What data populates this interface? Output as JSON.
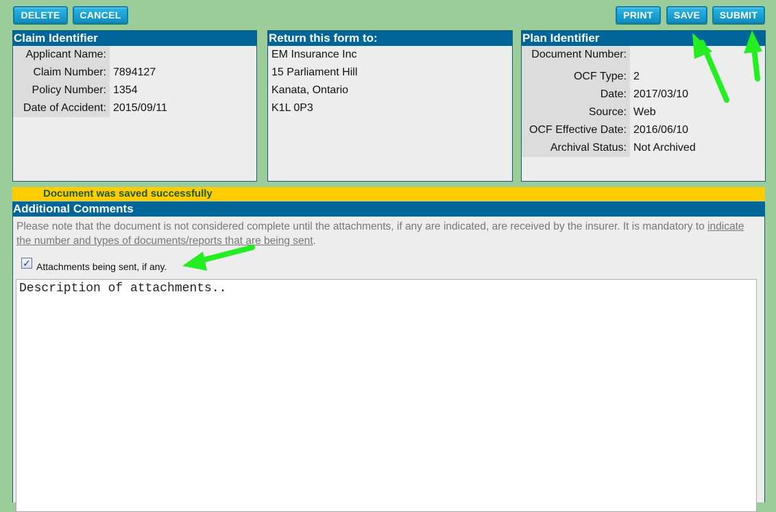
{
  "toolbar": {
    "delete_label": "DELETE",
    "cancel_label": "CANCEL",
    "print_label": "PRINT",
    "save_label": "SAVE",
    "submit_label": "SUBMIT"
  },
  "claim_panel": {
    "title": "Claim Identifier",
    "fields": [
      {
        "label": "Applicant Name:",
        "value": ""
      },
      {
        "label": "Claim Number:",
        "value": "7894127"
      },
      {
        "label": "Policy Number:",
        "value": "1354"
      },
      {
        "label": "Date of Accident:",
        "value": "2015/09/11"
      }
    ]
  },
  "return_panel": {
    "title": "Return this form to:",
    "lines": [
      "EM Insurance Inc",
      "15 Parliament Hill",
      "Kanata, Ontario",
      "K1L 0P3"
    ]
  },
  "plan_panel": {
    "title": "Plan Identifier",
    "fields": [
      {
        "label": "Document Number:",
        "value": ""
      },
      {
        "label": "OCF Type:",
        "value": "2"
      },
      {
        "label": "Date:",
        "value": "2017/03/10"
      },
      {
        "label": "Source:",
        "value": "Web"
      },
      {
        "label": "OCF Effective Date:",
        "value": "2016/06/10"
      },
      {
        "label": "Archival Status:",
        "value": "Not Archived"
      }
    ]
  },
  "status": {
    "message": "Document was saved successfully"
  },
  "comments": {
    "title": "Additional Comments",
    "note_text": "Please note that the document is not considered complete until the attachments, if any are indicated, are received by the insurer. It is mandatory to ",
    "note_underlined": "indicate the number and types of documents/reports that are being sent",
    "note_end": ".",
    "checkbox_label": "Attachments being sent, if any.",
    "checkbox_checked": true,
    "checkbox_mark": "✓",
    "textarea_value": "Description of attachments.."
  },
  "annotation_colors": {
    "arrow": "#22ee22"
  }
}
